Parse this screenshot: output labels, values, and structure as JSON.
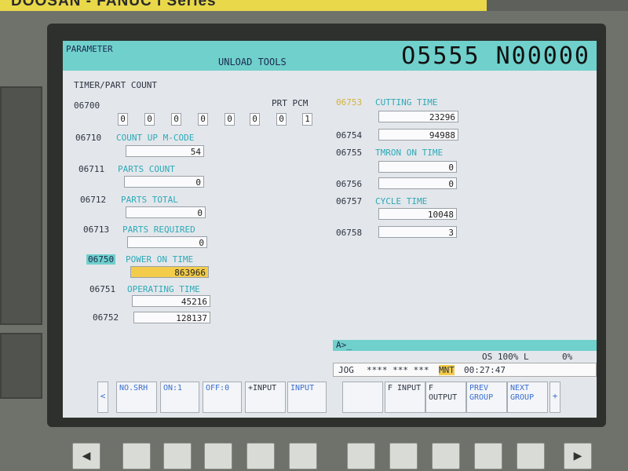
{
  "brand": "DOOSAN - FANUC i Series",
  "header": {
    "mode": "PARAMETER",
    "title": "UNLOAD TOOLS",
    "program": "O5555 N00000"
  },
  "section_title": "TIMER/PART COUNT",
  "p6700": {
    "num": "06700",
    "tag": "PRT PCM",
    "bits": [
      "0",
      "0",
      "0",
      "0",
      "0",
      "0",
      "0",
      "1"
    ]
  },
  "left_params": [
    {
      "num": "06710",
      "label": "COUNT UP M-CODE",
      "value": "54"
    },
    {
      "num": "06711",
      "label": "PARTS COUNT",
      "value": "0"
    },
    {
      "num": "06712",
      "label": "PARTS TOTAL",
      "value": "0"
    },
    {
      "num": "06713",
      "label": "PARTS REQUIRED",
      "value": "0"
    },
    {
      "num": "06750",
      "label": "POWER ON TIME",
      "value": "863966"
    },
    {
      "num": "06751",
      "label": "OPERATING TIME",
      "value": "45216"
    },
    {
      "num": "06752",
      "label": "",
      "value": "128137"
    }
  ],
  "right_params": [
    {
      "num": "06753",
      "label": "CUTTING TIME",
      "value": "23296"
    },
    {
      "num": "06754",
      "label": "",
      "value": "94988"
    },
    {
      "num": "06755",
      "label": "TMRON ON TIME",
      "value": "0"
    },
    {
      "num": "06756",
      "label": "",
      "value": "0"
    },
    {
      "num": "06757",
      "label": "CYCLE TIME",
      "value": "10048"
    },
    {
      "num": "06758",
      "label": "",
      "value": "3"
    }
  ],
  "command_line": "A>_",
  "status": {
    "override": "OS 100% L",
    "percent": "0%",
    "mode": "JOG",
    "stars": "**** *** ***",
    "mnt": "MNT",
    "time": "00:27:47"
  },
  "softkeys": {
    "left_arrow": "<",
    "right_arrow": "+",
    "items": [
      "NO.SRH",
      "ON:1",
      "OFF:0",
      "+INPUT",
      "INPUT",
      "",
      "F INPUT",
      "F OUTPUT",
      "PREV GROUP",
      "NEXT GROUP"
    ]
  },
  "hw_keys": {
    "left": "◀",
    "right": "▶"
  }
}
